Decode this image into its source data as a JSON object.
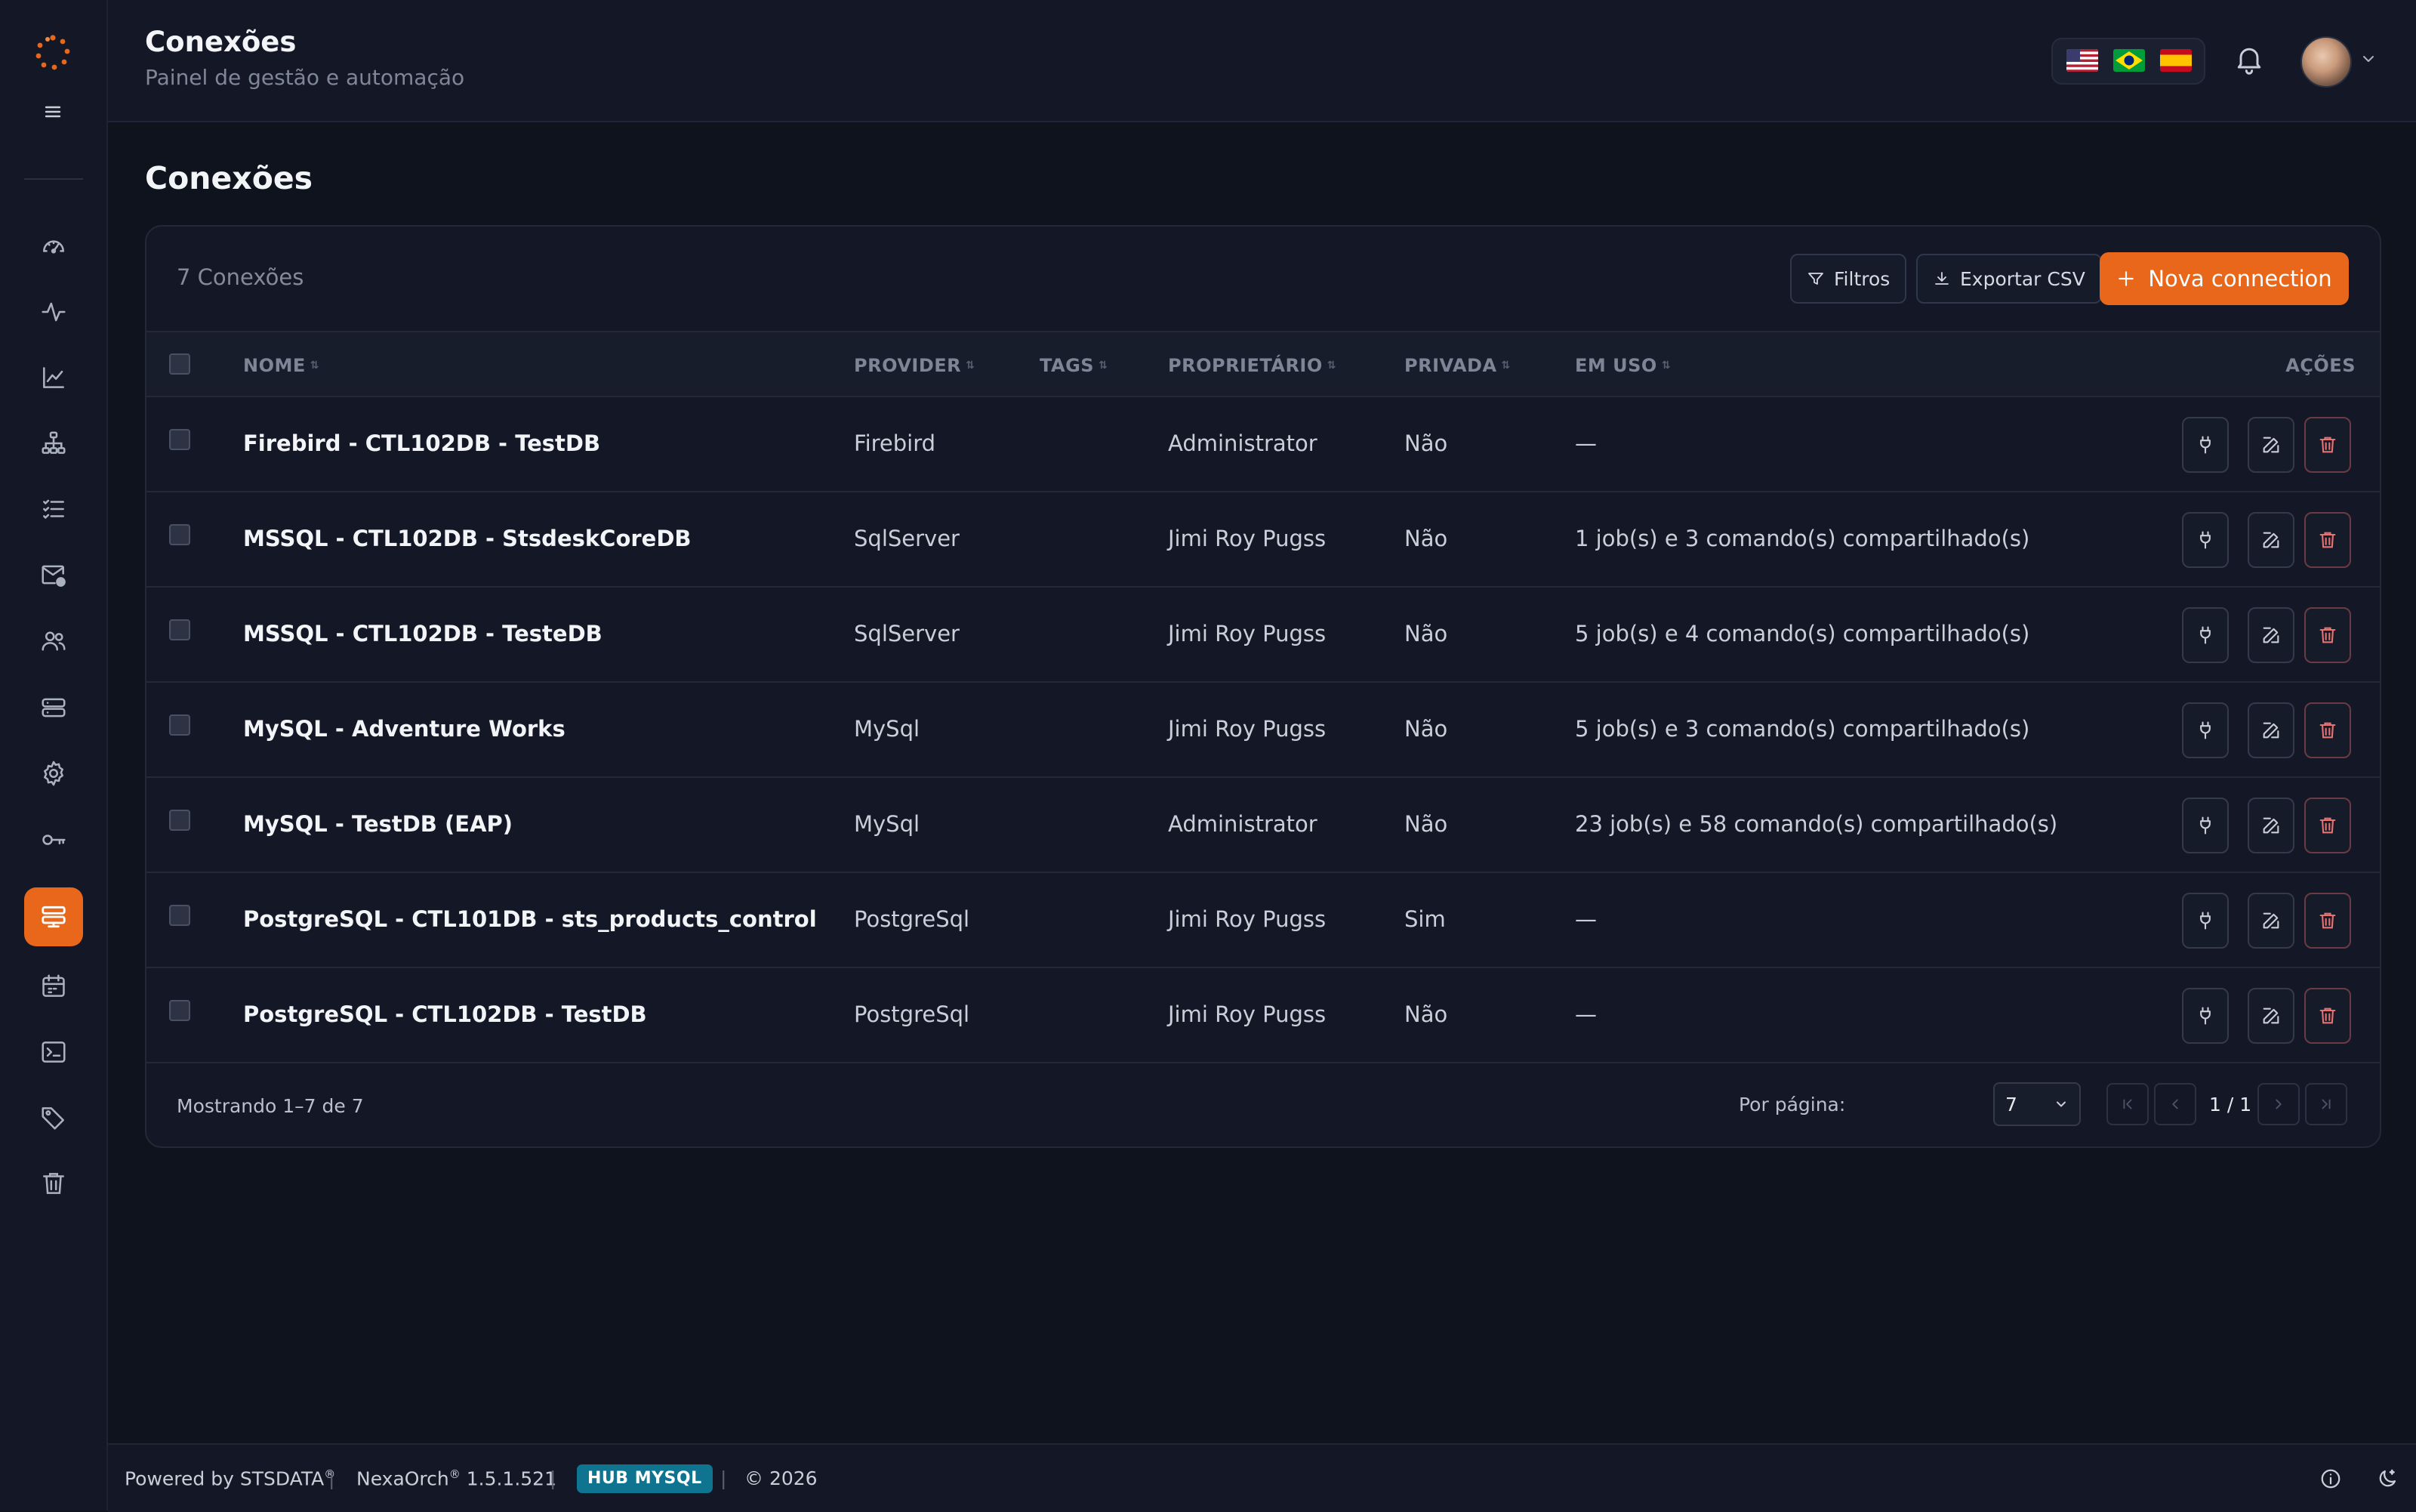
{
  "header": {
    "title": "Conexões",
    "subtitle": "Painel de gestão e automação",
    "languages": [
      "en-US",
      "pt-BR",
      "es"
    ]
  },
  "sidebar": {
    "items": [
      {
        "icon": "dashboard-icon"
      },
      {
        "icon": "activity-icon"
      },
      {
        "icon": "chart-line-icon"
      },
      {
        "icon": "sitemap-icon"
      },
      {
        "icon": "task-list-icon"
      },
      {
        "icon": "mail-alert-icon"
      },
      {
        "icon": "users-icon"
      },
      {
        "icon": "server-icon"
      },
      {
        "icon": "settings-icon"
      },
      {
        "icon": "key-icon"
      },
      {
        "icon": "connections-icon",
        "active": true
      },
      {
        "icon": "calendar-icon"
      },
      {
        "icon": "terminal-icon"
      },
      {
        "icon": "tags-icon"
      },
      {
        "icon": "trash-icon"
      }
    ]
  },
  "main": {
    "title": "Conexões",
    "count_label": "7 Conexões",
    "filters_label": "Filtros",
    "export_label": "Exportar CSV",
    "new_label": "Nova connection"
  },
  "table": {
    "columns": {
      "name": "NOME",
      "provider": "PROVIDER",
      "tags": "TAGS",
      "owner": "PROPRIETÁRIO",
      "private": "PRIVADA",
      "in_use": "EM USO",
      "actions": "AÇÕES"
    },
    "rows": [
      {
        "name": "Firebird - CTL102DB - TestDB",
        "provider": "Firebird",
        "owner": "Administrator",
        "private": "Não",
        "in_use": "—"
      },
      {
        "name": "MSSQL - CTL102DB - StsdeskCoreDB",
        "provider": "SqlServer",
        "owner": "Jimi Roy Pugss",
        "private": "Não",
        "in_use": "1 job(s) e 3 comando(s) compartilhado(s)"
      },
      {
        "name": "MSSQL - CTL102DB - TesteDB",
        "provider": "SqlServer",
        "owner": "Jimi Roy Pugss",
        "private": "Não",
        "in_use": "5 job(s) e 4 comando(s) compartilhado(s)"
      },
      {
        "name": "MySQL - Adventure Works",
        "provider": "MySql",
        "owner": "Jimi Roy Pugss",
        "private": "Não",
        "in_use": "5 job(s) e 3 comando(s) compartilhado(s)"
      },
      {
        "name": "MySQL - TestDB (EAP)",
        "provider": "MySql",
        "owner": "Administrator",
        "private": "Não",
        "in_use": "23 job(s) e 58 comando(s) compartilhado(s)"
      },
      {
        "name": "PostgreSQL - CTL101DB - sts_products_control",
        "provider": "PostgreSql",
        "owner": "Jimi Roy Pugss",
        "private": "Sim",
        "in_use": "—"
      },
      {
        "name": "PostgreSQL - CTL102DB - TestDB",
        "provider": "PostgreSql",
        "owner": "Jimi Roy Pugss",
        "private": "Não",
        "in_use": "—"
      }
    ]
  },
  "pagination": {
    "showing": "Mostrando 1–7 de 7",
    "per_page_label": "Por página:",
    "per_page_value": "7",
    "page_indicator": "1 / 1"
  },
  "footer": {
    "powered": "Powered by STSDATA",
    "product": "NexaOrch",
    "version": "1.5.1.521",
    "hub": "HUB MYSQL",
    "copyright": "© 2026",
    "registered": "®"
  },
  "colors": {
    "accent": "#e8671a",
    "background": "#0f131e",
    "panel": "#141826",
    "hub_badge": "#0e7490",
    "danger": "#e87272"
  }
}
